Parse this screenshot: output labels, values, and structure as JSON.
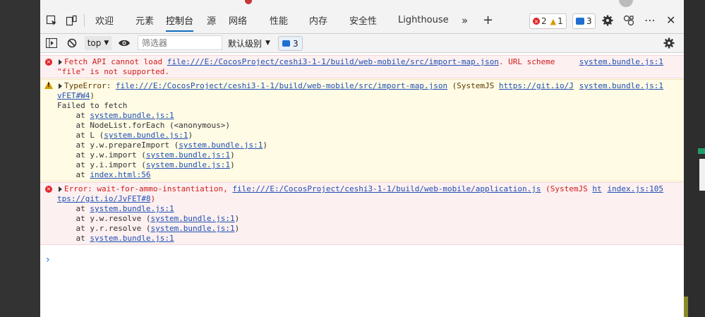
{
  "tabs": [
    {
      "label": "欢迎"
    },
    {
      "label": "元素"
    },
    {
      "label": "控制台"
    },
    {
      "label": "源"
    },
    {
      "label": "网络"
    },
    {
      "label": "性能"
    },
    {
      "label": "内存"
    },
    {
      "label": "安全性"
    },
    {
      "label": "Lighthouse"
    }
  ],
  "status": {
    "errors": "2",
    "warnings": "1",
    "messages": "3"
  },
  "toolbar": {
    "context": "top",
    "filter_placeholder": "筛选器",
    "levels": "默认级别",
    "messages_count": "3"
  },
  "messages": [
    {
      "level": "error",
      "lines": [
        {
          "text": "Fetch API cannot load ",
          "link": "file:///E:/CocosProject/ceshi3-1-1/build/web-mobile/src/import-map.json",
          "after": ". URL scheme"
        },
        {
          "text": "\"file\" is not supported."
        }
      ],
      "source": "system.bundle.js:1"
    },
    {
      "level": "warning",
      "lines": [
        {
          "text": "TypeError: ",
          "link": "file:///E:/CocosProject/ceshi3-1-1/build/web-mobile/src/import-map.json",
          "after": " (SystemJS ",
          "link2": "https://git.io/J"
        },
        {
          "pre_link": "vFET#W4",
          "text": ")"
        },
        {
          "text": "Failed to fetch"
        },
        {
          "text": "    at ",
          "link": "system.bundle.js:1"
        },
        {
          "text": "    at NodeList.forEach (<anonymous>)"
        },
        {
          "text": "    at L (",
          "link": "system.bundle.js:1",
          "after": ")"
        },
        {
          "text": "    at y.w.prepareImport (",
          "link": "system.bundle.js:1",
          "after": ")"
        },
        {
          "text": "    at y.w.import (",
          "link": "system.bundle.js:1",
          "after": ")"
        },
        {
          "text": "    at y.i.import (",
          "link": "system.bundle.js:1",
          "after": ")"
        },
        {
          "text": "    at ",
          "link": "index.html:56"
        }
      ],
      "source": "system.bundle.js:1"
    },
    {
      "level": "error",
      "lines": [
        {
          "text": "Error: wait-for-ammo-instantiation, ",
          "link": "file:///E:/CocosProject/ceshi3-1-1/build/web-mobile/application.js",
          "after": " (SystemJS ",
          "link2": "ht"
        },
        {
          "pre_link": "tps://git.io/JvFET#8",
          "text": ")"
        },
        {
          "text": "    at ",
          "link": "system.bundle.js:1"
        },
        {
          "text": "    at y.w.resolve (",
          "link": "system.bundle.js:1",
          "after": ")"
        },
        {
          "text": "    at y.r.resolve (",
          "link": "system.bundle.js:1",
          "after": ")"
        },
        {
          "text": "    at ",
          "link": "system.bundle.js:1"
        }
      ],
      "source": "index.js:105"
    }
  ]
}
